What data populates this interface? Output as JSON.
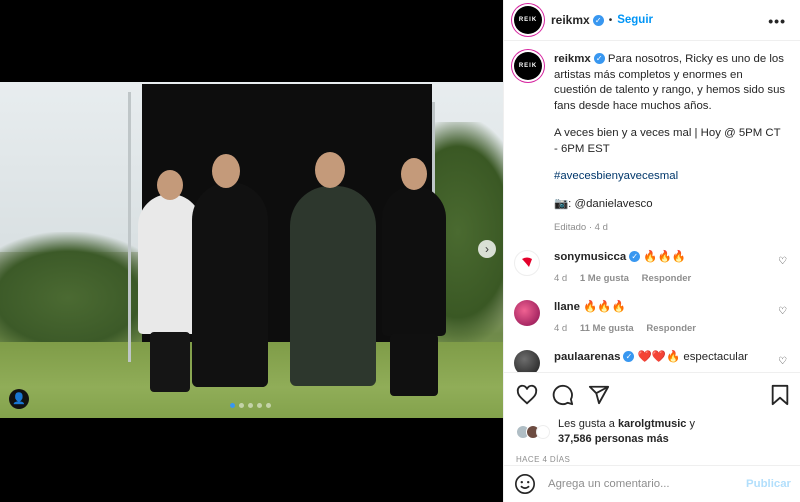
{
  "post": {
    "username": "reikmx",
    "avatar_text": "REIK",
    "follow_label": "Seguir",
    "separator": "•",
    "more_label": "•••"
  },
  "caption": {
    "username": "reikmx",
    "text": "Para nosotros, Ricky es uno de los artistas más completos y enormes en cuestión de talento y rango, y hemos sido sus fans desde hace muchos años.",
    "line2": "A veces bien y a veces mal | Hoy @ 5PM CT - 6PM EST",
    "hashtag": "#avecesbienyavecesmal",
    "credit": "📷: @danielavesco",
    "edited": "Editado · 4 d"
  },
  "comments": [
    {
      "username": "sonymusicca",
      "text": "🔥🔥🔥",
      "time": "4 d",
      "likes": "1 Me gusta",
      "reply": "Responder",
      "avatar_color": "#ffffff"
    },
    {
      "username": "llane",
      "text": "🔥🔥🔥",
      "time": "4 d",
      "likes": "11 Me gusta",
      "reply": "Responder",
      "avatar_color": "#c2185b"
    },
    {
      "username": "paulaarenas",
      "text": "❤️❤️🔥 espectacular",
      "time": "",
      "likes": "",
      "reply": "",
      "avatar_color": "#222222"
    }
  ],
  "likes": {
    "prefix": "Les gusta a ",
    "user": "karolgtmusic",
    "middle": " y",
    "count": "37,586 personas más"
  },
  "date": "HACE 4 DÍAS",
  "add_comment": {
    "placeholder": "Agrega un comentario...",
    "post_label": "Publicar"
  },
  "carousel": {
    "total": 5,
    "active": 1
  },
  "colors": {
    "accent": "#0095f6",
    "verified": "#3897f0",
    "hashtag": "#00376b"
  }
}
